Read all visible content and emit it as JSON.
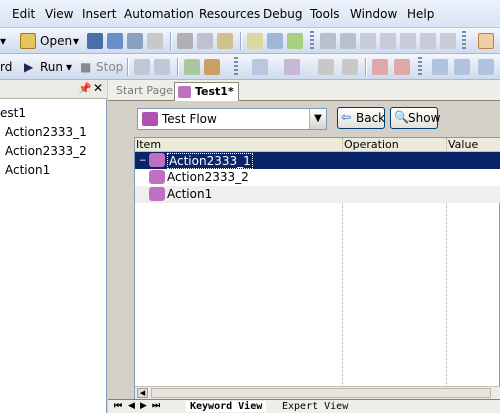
{
  "menu": [
    "Edit",
    "View",
    "Insert",
    "Automation",
    "Resources",
    "Debug",
    "Tools",
    "Window",
    "Help"
  ],
  "toolbar1": {
    "open_label": "Open"
  },
  "toolbar2": {
    "record_label": "rd",
    "run_label": "Run",
    "stop_label": "Stop"
  },
  "left_panel": {
    "tree": [
      "est1",
      "Action2333_1",
      "Action2333_2",
      "Action1"
    ]
  },
  "doc_tabs": [
    "Start Page",
    "Test1*"
  ],
  "flow_selector": {
    "value": "Test Flow"
  },
  "buttons": {
    "back": "Back",
    "show": "Show"
  },
  "grid": {
    "columns": [
      "Item",
      "Operation",
      "Value"
    ],
    "rows": [
      {
        "label": "Action2333_1",
        "selected": true
      },
      {
        "label": "Action2333_2",
        "selected": false
      },
      {
        "label": "Action1",
        "selected": false
      }
    ]
  },
  "bottom_tabs": [
    "Keyword View",
    "Expert View"
  ],
  "colors": {
    "selection": "#0a246a",
    "accent": "#316ac5"
  }
}
